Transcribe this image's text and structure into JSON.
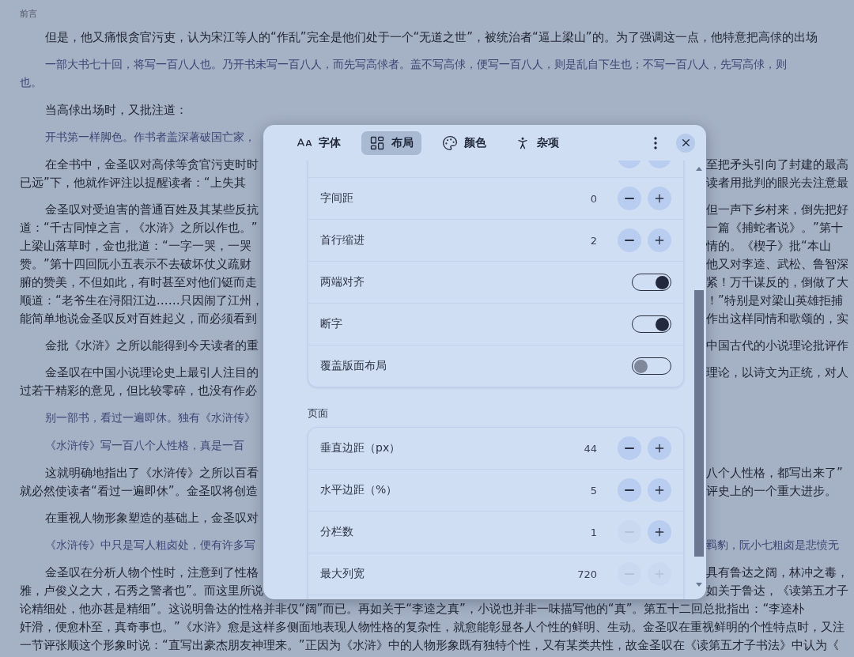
{
  "reader": {
    "header": "前言",
    "paragraphs": [
      {
        "kind": "body",
        "lines": [
          {
            "left": "但是，他又痛恨贪官污吏，认为宋江等人的“作乱”完全是他们处于一个“无道之世”，被统治者“逼上梁山”的。为了强调这一点，他特意把高俅的出场"
          }
        ]
      },
      {
        "kind": "quote",
        "lines": [
          {
            "left": "一部大书七十回，将写一百八人也。乃开书未写一百八人，而先写高俅者。盖不写高俅，便写一百八人，则是乱自下生也；不写一百八人，先写高俅，则"
          },
          {
            "left": "也。"
          }
        ]
      },
      {
        "kind": "body",
        "lines": [
          {
            "left": "当高俅出场时，又批注道："
          }
        ]
      },
      {
        "kind": "quote",
        "lines": [
          {
            "left": "开书第一样脚色。作书者盖深著破国亡家，"
          }
        ]
      },
      {
        "kind": "body",
        "lines": [
          {
            "left": "在全书中，金圣叹对高俅等贪官污吏时时",
            "right": "至把矛头引向了封建的最高"
          },
          {
            "left": "已远”下，他就作评注以提醒读者：“上失其",
            "right": "读者用批判的眼光去注意最"
          }
        ]
      },
      {
        "kind": "body",
        "lines": [
          {
            "left": "金圣叹对受迫害的普通百姓及其某些反抗",
            "right": "但一声下乡村来，倒先把好"
          },
          {
            "left": "道：“千古同悼之言，《水浒》之所以作也。”",
            "right": "一篇《捕蛇者说》。”第十"
          },
          {
            "left": "上梁山落草时，金也批道：“一字一哭，一哭",
            "right": "情的。《楔子》批“本山"
          },
          {
            "left": "赞。”第十四回阮小五表示不去破坏仗义疏财",
            "right": "他又对李逵、武松、鲁智深"
          },
          {
            "left": "腑的赞美，不但如此，有时甚至对他们铤而走",
            "right": "紧！万千谋反的，倒做了大"
          },
          {
            "left": "顺道：“老爷生在浔阳江边……只因闹了江州，",
            "right": "！”特别是对梁山英雄拒捕"
          },
          {
            "left": "能简单地说金圣叹反对百姓起义，而必须看到",
            "right": "作出这样同情和歌颂的，实"
          }
        ]
      },
      {
        "kind": "body",
        "lines": [
          {
            "left": "金批《水浒》之所以能得到今天读者的重",
            "right": "中国古代的小说理论批评作"
          }
        ]
      },
      {
        "kind": "body",
        "lines": [
          {
            "left": "金圣叹在中国小说理论史上最引人注目的",
            "right": "理论，以诗文为正统，对人"
          },
          {
            "left": "过若干精彩的意见，但比较零碎，也没有作必"
          }
        ]
      },
      {
        "kind": "quote",
        "lines": [
          {
            "left": "别一部书，看过一遍即休。独有《水浒传》"
          }
        ]
      },
      {
        "kind": "quote",
        "lines": [
          {
            "left": "《水浒传》写一百八个人性格，真是一百"
          }
        ]
      },
      {
        "kind": "body",
        "lines": [
          {
            "left": "这就明确地指出了《水浒传》之所以百看",
            "right": "八个人性格，都写出来了”"
          },
          {
            "left": "就必然使读者“看过一遍即休”。金圣叹将创造",
            "right": "评史上的一个重大进步。"
          }
        ]
      },
      {
        "kind": "body",
        "lines": [
          {
            "left": "在重视人物形象塑造的基础上，金圣叹对"
          }
        ]
      },
      {
        "kind": "quote",
        "lines": [
          {
            "left": "《水浒传》中只是写人粗卤处，便有许多写",
            "right": "羁豹，阮小七粗卤是悲愤无"
          }
        ]
      },
      {
        "kind": "body",
        "lines": [
          {
            "left": "金圣叹在分析人物个性时，注意到了性格",
            "right": "具有鲁达之阔，林冲之毒，"
          },
          {
            "left": "雅，卢俊义之大，石秀之警者也”。而这里所说",
            "right": "如关于鲁达，《读第五才子"
          },
          {
            "left": "论精细处，他亦甚是精细”。这说明鲁达的性格并非仅“阔”而已。再如关于“李逵之真”，小说也并非一味描写他的“真”。第五十二回总批指出：“李逵朴"
          },
          {
            "left": "奸滑，便愈朴至，真奇事也。”《水浒》愈是这样多侧面地表现人物性格的复杂性，就愈能彰显各人个性的鲜明、生动。金圣叹在重视鲜明的个性特点时，又注"
          },
          {
            "left": "一节评张顺这个形象时说：“直写出豪杰朋友神理来。”正因为《水浒》中的人物形象既有独特个性，又有某类共性，故金圣叹在《读第五才子书法》中认为《"
          }
        ]
      }
    ]
  },
  "dialog": {
    "tabs": [
      {
        "label": "字体",
        "selected": false
      },
      {
        "label": "布局",
        "selected": true
      },
      {
        "label": "颜色",
        "selected": false
      },
      {
        "label": "杂项",
        "selected": false
      }
    ],
    "sections": [
      {
        "rows": [
          {
            "kind": "cut"
          },
          {
            "kind": "stepper",
            "label": "字间距",
            "value": "0",
            "decrease_disabled": false,
            "increase_disabled": false
          },
          {
            "kind": "stepper",
            "label": "首行缩进",
            "value": "2",
            "decrease_disabled": false,
            "increase_disabled": false
          },
          {
            "kind": "toggle",
            "label": "两端对齐",
            "on": true
          },
          {
            "kind": "toggle",
            "label": "断字",
            "on": true
          },
          {
            "kind": "toggle",
            "label": "覆盖版面布局",
            "on": false
          }
        ]
      },
      {
        "title": "页面",
        "rows": [
          {
            "kind": "stepper",
            "label": "垂直边距（px）",
            "value": "44",
            "decrease_disabled": false,
            "increase_disabled": false
          },
          {
            "kind": "stepper",
            "label": "水平边距（%）",
            "value": "5",
            "decrease_disabled": false,
            "increase_disabled": false
          },
          {
            "kind": "stepper",
            "label": "分栏数",
            "value": "1",
            "decrease_disabled": true,
            "increase_disabled": false
          },
          {
            "kind": "stepper",
            "label": "最大列宽",
            "value": "720",
            "decrease_disabled": true,
            "increase_disabled": true
          },
          {
            "kind": "cut"
          }
        ]
      }
    ]
  }
}
